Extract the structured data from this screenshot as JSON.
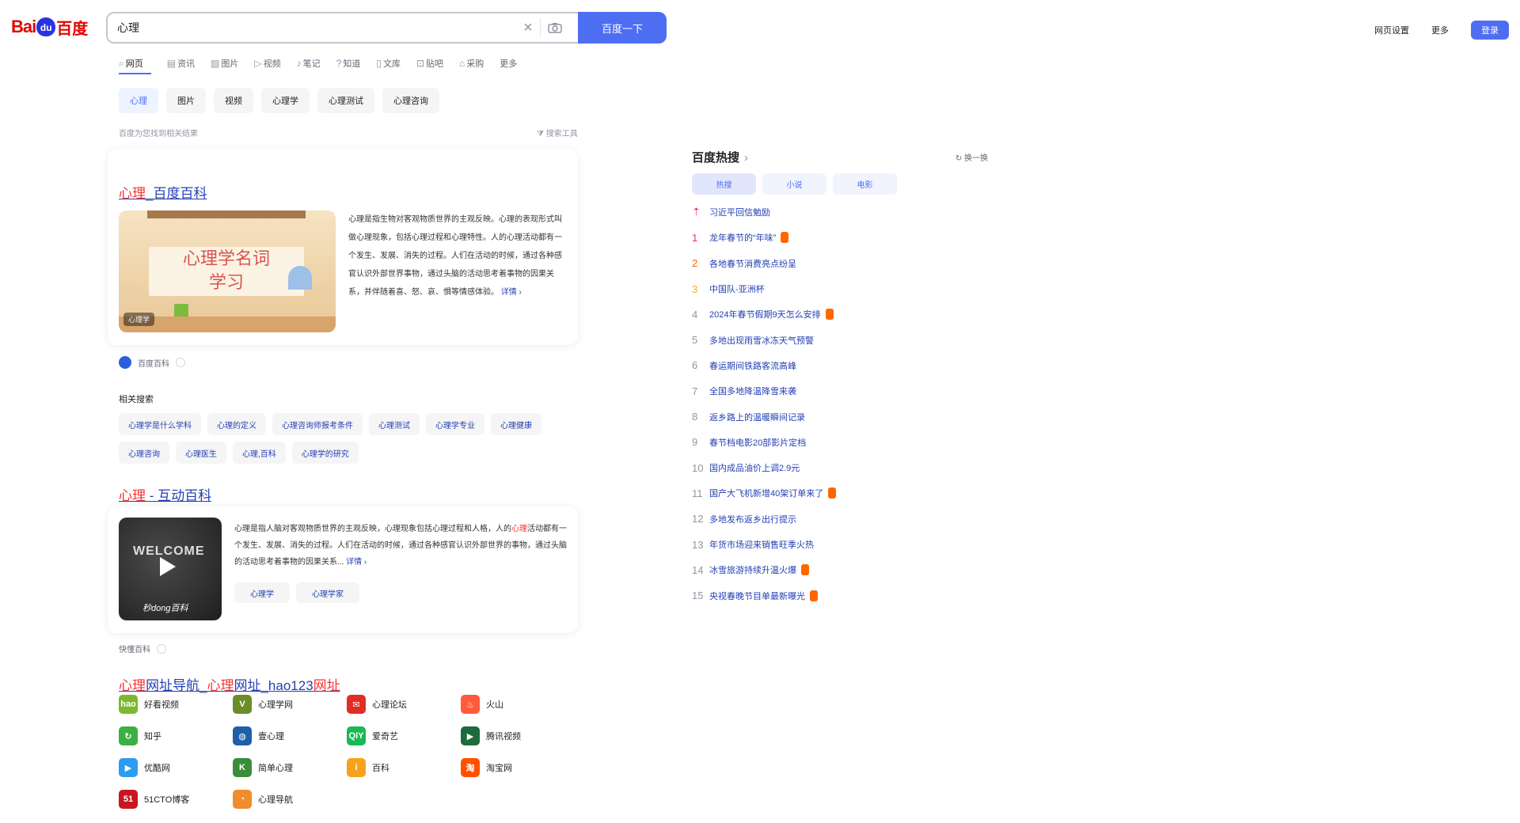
{
  "search": {
    "query": "心理",
    "placeholder": "",
    "button": "百度一下",
    "clear_icon": "×",
    "camera_icon": "camera-icon"
  },
  "logo": {
    "bai": "Bai",
    "du": "du",
    "cn": "百度"
  },
  "topbar": {
    "settings": "网页设置",
    "more": "更多",
    "login": "登录"
  },
  "tabs": [
    {
      "icon": "⌕",
      "label": "网页"
    },
    {
      "icon": "▤",
      "label": "资讯"
    },
    {
      "icon": "▨",
      "label": "图片"
    },
    {
      "icon": "▷",
      "label": "视频"
    },
    {
      "icon": "♪",
      "label": "笔记"
    },
    {
      "icon": "?",
      "label": "知道"
    },
    {
      "icon": "▯",
      "label": "文库"
    },
    {
      "icon": "⊡",
      "label": "贴吧"
    },
    {
      "icon": "⌂",
      "label": "采购"
    },
    {
      "icon": "",
      "label": "更多"
    }
  ],
  "chips": [
    "心理",
    "图片",
    "视频",
    "心理学",
    "心理测试",
    "心理咨询"
  ],
  "result_hint": "百度为您找到相关结果",
  "tools": "搜索工具",
  "result1": {
    "title_em": "心理",
    "title_rest": "_百度百科",
    "video_tag": "心理学",
    "board_line1": "心理学名词",
    "board_line2": "学习",
    "text": "心理是指生物对客观物质世界的主观反映。心理的表现形式叫做心理现象，包括心理过程和心理特性。人的心理活动都有一个发生、发展、消失的过程。人们在活动的时候，通过各种感官认识外部世界事物，通过头脑的活动思考着事物的因果关系，并伴随着喜、怒、哀、惧等情感体验。",
    "more": "详情",
    "source": "百度百科"
  },
  "related": {
    "heading": "相关搜索",
    "items": [
      "心理学是什么学科",
      "心理的定义",
      "心理咨询师报考条件",
      "心理测试",
      "心理学专业",
      "心理健康",
      "心理咨询",
      "心理医生",
      "心理,百科",
      "心理学的研究"
    ]
  },
  "result2": {
    "title_em": "心理",
    "title_rest": " - 互动百科",
    "text_a": "心理是指人脑对客观物质世界的主观反映，心理现象包括心理过程和人格，人的",
    "text_em": "心理",
    "text_b": "活动都有一个发生、发展、消失的过程。人们在活动的时候，通过各种感官认识外部世界的事物，通过头脑的活动思考着事物的因果关系...",
    "more": "详情",
    "btn1": "心理学",
    "btn2": "心理学家",
    "welcome": "WELCOME",
    "brand": "秒dong百科",
    "source": "快懂百科"
  },
  "result3": {
    "title_em": "心理",
    "title_mid": "网址导航_",
    "title_em2": "心理",
    "title_mid2": "网址_hao123",
    "title_em3": "网址"
  },
  "sites": [
    {
      "name": "好看视频",
      "icon": "hao",
      "color": "#7cb82f"
    },
    {
      "name": "心理学网",
      "icon": "V",
      "color": "#6a8d2a"
    },
    {
      "name": "心理论坛",
      "icon": "✉",
      "color": "#e02e24"
    },
    {
      "name": "火山",
      "icon": "♨",
      "color": "#ff5a3c"
    },
    {
      "name": "知乎",
      "icon": "↻",
      "color": "#3cb043"
    },
    {
      "name": "壹心理",
      "icon": "◍",
      "color": "#1e5fa8"
    },
    {
      "name": "爱奇艺",
      "icon": "QIY",
      "color": "#19b955"
    },
    {
      "name": "腾讯视频",
      "icon": "▶",
      "color": "#1d6b3a"
    },
    {
      "name": "优酷网",
      "icon": "▶",
      "color": "#2d9cf0"
    },
    {
      "name": "简单心理",
      "icon": "K",
      "color": "#3b8c3b"
    },
    {
      "name": "百科",
      "icon": "i",
      "color": "#f7a21b"
    },
    {
      "name": "淘宝网",
      "icon": "淘",
      "color": "#ff5000"
    },
    {
      "name": "51CTO博客",
      "icon": "51",
      "color": "#c9161d"
    },
    {
      "name": "心理导航",
      "icon": "◔",
      "color": "#f08c2b"
    }
  ],
  "hot": {
    "title": "百度热搜",
    "refresh": "换一换",
    "tabs": [
      "热搜",
      "小说",
      "电影"
    ],
    "items": [
      {
        "rank": "⇡",
        "text": "习近平回信勉励",
        "badge": false
      },
      {
        "rank": "1",
        "text": "龙年春节的“年味”",
        "badge": true
      },
      {
        "rank": "2",
        "text": "各地春节消费亮点纷呈",
        "badge": false
      },
      {
        "rank": "3",
        "text": "中国队-亚洲杯",
        "badge": false
      },
      {
        "rank": "4",
        "text": "2024年春节假期9天怎么安排",
        "badge": true
      },
      {
        "rank": "5",
        "text": "多地出现雨雪冰冻天气预警",
        "badge": false
      },
      {
        "rank": "6",
        "text": "春运期间铁路客流高峰",
        "badge": false
      },
      {
        "rank": "7",
        "text": "全国多地降温降雪来袭",
        "badge": false
      },
      {
        "rank": "8",
        "text": "返乡路上的温暖瞬间记录",
        "badge": false
      },
      {
        "rank": "9",
        "text": "春节档电影20部影片定档",
        "badge": false
      },
      {
        "rank": "10",
        "text": "国内成品油价上调2.9元",
        "badge": false
      },
      {
        "rank": "11",
        "text": "国产大飞机新增40架订单来了",
        "badge": true
      },
      {
        "rank": "12",
        "text": "多地发布返乡出行提示",
        "badge": false
      },
      {
        "rank": "13",
        "text": "年货市场迎来销售旺季火热",
        "badge": false
      },
      {
        "rank": "14",
        "text": "冰雪旅游持续升温火爆",
        "badge": true
      },
      {
        "rank": "15",
        "text": "央视春晚节目单最新曝光",
        "badge": true
      }
    ]
  }
}
